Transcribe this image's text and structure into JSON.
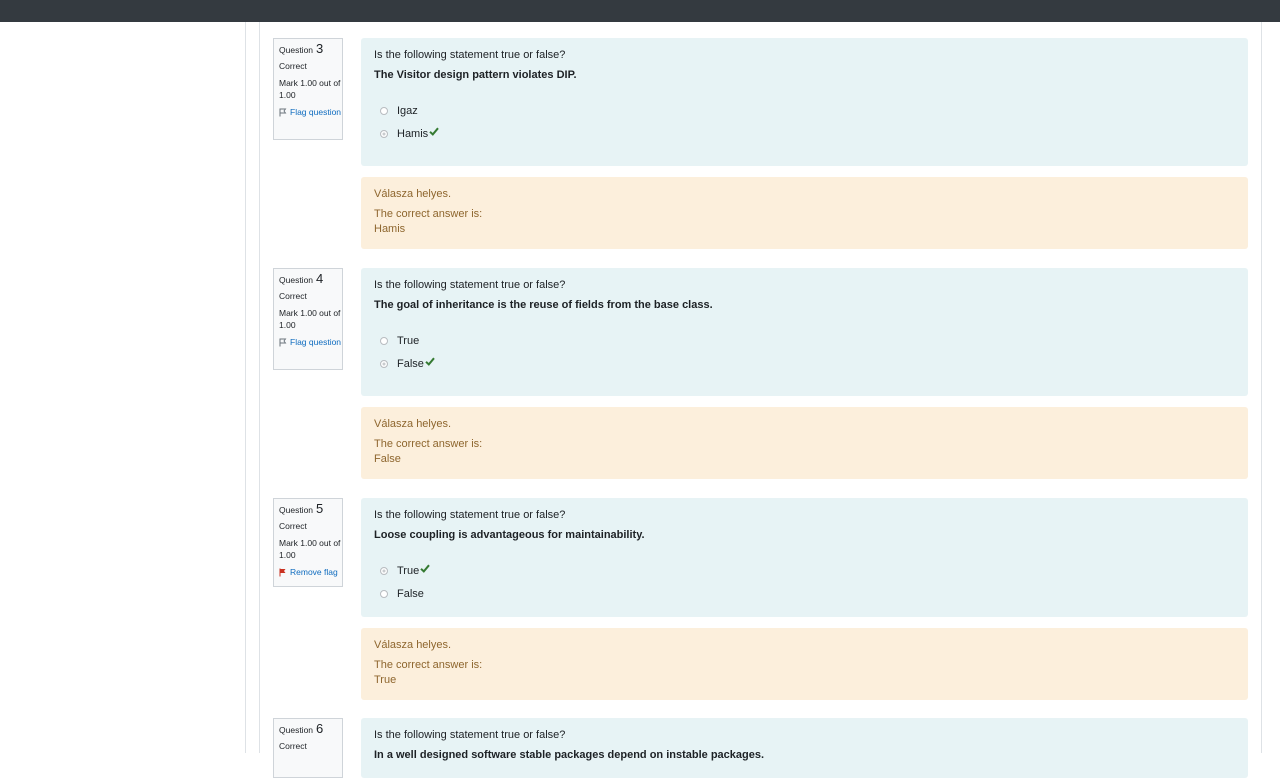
{
  "colors": {
    "topbar": "#343a40",
    "formulation_bg": "#e7f3f5",
    "outcome_bg": "#fcefdc",
    "outcome_text": "#8e662e",
    "link": "#0f6cbf",
    "correct_tick": "#357a32",
    "flag_red": "#ca3120"
  },
  "questions": [
    {
      "word": "Question",
      "number": "3",
      "state": "Correct",
      "grade": "Mark 1.00 out of 1.00",
      "flag_label": "Flag question",
      "flag_icon": "flag-outline-icon",
      "intro": "Is the following statement true or false?",
      "statement": "The Visitor design pattern violates DIP.",
      "answers": [
        {
          "label": "Igaz",
          "checked": false,
          "correct": false
        },
        {
          "label": "Hamis",
          "checked": true,
          "correct": true
        }
      ],
      "feedback": "Válasza helyes.",
      "right_answer_intro": "The correct answer is:",
      "right_answer": "Hamis"
    },
    {
      "word": "Question",
      "number": "4",
      "state": "Correct",
      "grade": "Mark 1.00 out of 1.00",
      "flag_label": "Flag question",
      "flag_icon": "flag-outline-icon",
      "intro": "Is the following statement true or false?",
      "statement": "The goal of inheritance is the reuse of fields from the base class.",
      "answers": [
        {
          "label": "True",
          "checked": false,
          "correct": false
        },
        {
          "label": "False",
          "checked": true,
          "correct": true
        }
      ],
      "feedback": "Válasza helyes.",
      "right_answer_intro": "The correct answer is:",
      "right_answer": "False"
    },
    {
      "word": "Question",
      "number": "5",
      "state": "Correct",
      "grade": "Mark 1.00 out of 1.00",
      "flag_label": "Remove flag",
      "flag_icon": "flag-filled-red-icon",
      "intro": "Is the following statement true or false?",
      "statement": "Loose coupling is advantageous for maintainability.",
      "answers": [
        {
          "label": "True",
          "checked": true,
          "correct": true
        },
        {
          "label": "False",
          "checked": false,
          "correct": false
        }
      ],
      "feedback": "Válasza helyes.",
      "right_answer_intro": "The correct answer is:",
      "right_answer": "True"
    },
    {
      "word": "Question",
      "number": "6",
      "state": "Correct",
      "intro": "Is the following statement true or false?",
      "statement": "In a well designed software stable packages depend on instable packages."
    }
  ]
}
